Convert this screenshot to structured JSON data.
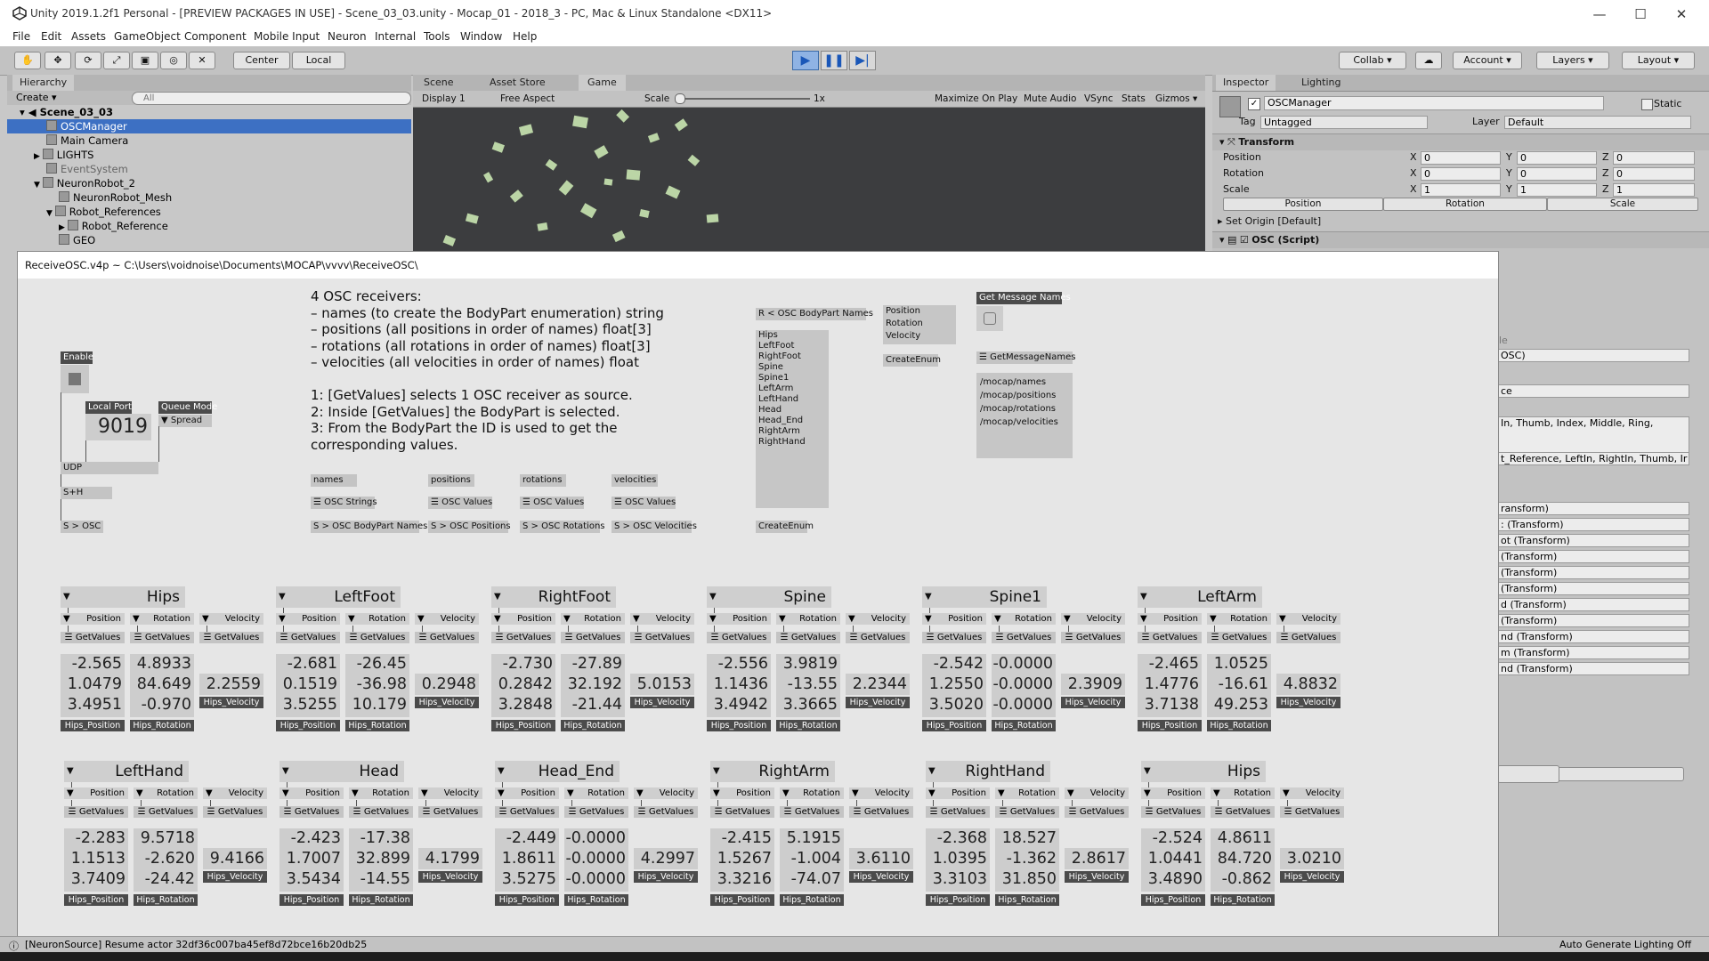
{
  "window": {
    "title": "Unity 2019.1.2f1 Personal - [PREVIEW PACKAGES IN USE] - Scene_03_03.unity - Mocap_01 - 2018_3 - PC, Mac & Linux Standalone <DX11>",
    "minimize": "—",
    "maximize": "☐",
    "close": "✕"
  },
  "menu": [
    "File",
    "Edit",
    "Assets",
    "GameObject",
    "Component",
    "Mobile Input",
    "Neuron",
    "Internal",
    "Tools",
    "Window",
    "Help"
  ],
  "toolbar": {
    "center": "Center",
    "local": "Local",
    "collab": "Collab ▾",
    "account": "Account ▾",
    "layers": "Layers ▾",
    "layout": "Layout ▾"
  },
  "hierarchy": {
    "tab": "Hierarchy",
    "create": "Create ▾",
    "search_placeholder": "All",
    "scene": "Scene_03_03",
    "items": [
      {
        "label": "OSCManager",
        "selected": true
      },
      {
        "label": "Main Camera"
      },
      {
        "label": "LIGHTS"
      },
      {
        "label": "EventSystem"
      },
      {
        "label": "NeuronRobot_2"
      },
      {
        "label": "NeuronRobot_Mesh"
      },
      {
        "label": "Robot_References"
      },
      {
        "label": "Robot_Reference"
      },
      {
        "label": "GEO"
      }
    ]
  },
  "game": {
    "tabs": [
      "Scene",
      "Asset Store",
      "Game"
    ],
    "display": "Display 1",
    "aspect": "Free Aspect",
    "scale_label": "Scale",
    "scale_value": "1x",
    "options": [
      "Maximize On Play",
      "Mute Audio",
      "VSync",
      "Stats",
      "Gizmos ▾"
    ]
  },
  "inspector": {
    "tabs": [
      "Inspector",
      "Lighting"
    ],
    "object_name": "OSCManager",
    "static_label": "Static",
    "tag_label": "Tag",
    "tag_value": "Untagged",
    "layer_label": "Layer",
    "layer_value": "Default",
    "transform_title": "Transform",
    "rows": [
      {
        "label": "Position",
        "x": "0",
        "y": "0",
        "z": "0"
      },
      {
        "label": "Rotation",
        "x": "0",
        "y": "0",
        "z": "0"
      },
      {
        "label": "Scale",
        "x": "1",
        "y": "1",
        "z": "1"
      }
    ],
    "buttons": [
      "Position",
      "Rotation",
      "Scale"
    ],
    "set_origin": "Set Origin [Default]",
    "script_title": "OSC (Script)",
    "partial_lines": [
      "le",
      "OSC)",
      "ce",
      "In, Thumb, Index, Middle, Ring,",
      "t_Reference, LeftIn, RightIn, Thumb, Ir",
      "ransform)",
      ": (Transform)",
      "ot (Transform)",
      "(Transform)",
      "(Transform)",
      "(Transform)",
      "d (Transform)",
      "(Transform)",
      "nd (Transform)",
      "m (Transform)",
      "nd (Transform)"
    ],
    "auto_generate": "Auto Generate Lighting Off"
  },
  "patch": {
    "title": "ReceiveOSC.v4p ~  C:\\Users\\voidnoise\\Documents\\MOCAP\\vvvv\\ReceiveOSC\\",
    "comment": "4 OSC receivers:\n– names (to create the BodyPart enumeration) string\n– positions (all positions in order of names) float[3]\n– rotations (all rotations in order of names) float[3]\n– velocities (all velocities in order of names) float\n\n1: [GetValues] selects 1 OSC receiver as source.\n2: Inside [GetValues] the BodyPart is selected.\n3: From the BodyPart the ID is used to get the\ncorresponding values.",
    "enable_label": "Enable",
    "local_port_label": "Local Port",
    "local_port": "9019",
    "queue_mode_label": "Queue Mode",
    "queue_mode": "Spread",
    "udp": "UDP",
    "sh": "S+H",
    "s_osc": "S > OSC",
    "receivers": [
      {
        "name": "names",
        "node": "OSC Strings",
        "send": "S > OSC BodyPart Names"
      },
      {
        "name": "positions",
        "node": "OSC Values",
        "send": "S > OSC Positions"
      },
      {
        "name": "rotations",
        "node": "OSC Values",
        "send": "S > OSC Rotations"
      },
      {
        "name": "velocities",
        "node": "OSC Values",
        "send": "S > OSC Velocities"
      }
    ],
    "bodypart_names_label": "R < OSC BodyPart Names",
    "bodypart_names": [
      "Hips",
      "LeftFoot",
      "RightFoot",
      "Spine",
      "Spine1",
      "LeftArm",
      "LeftHand",
      "Head",
      "Head_End",
      "RightArm",
      "RightHand"
    ],
    "create_enum_1": "CreateEnum",
    "enum_list": [
      "Position",
      "Rotation",
      "Velocity"
    ],
    "create_enum_2": "CreateEnum",
    "get_message_names": "Get Message Names",
    "get_message_names_node": "GetMessageNames",
    "message_names": [
      "/mocap/names",
      "/mocap/positions",
      "/mocap/rotations",
      "/mocap/velocities"
    ],
    "sub_labels": {
      "position": "Position",
      "rotation": "Rotation",
      "velocity": "Velocity",
      "getvalues": "GetValues",
      "pos_out": "Hips_Position",
      "rot_out": "Hips_Rotation",
      "vel_out": "Hips_Velocity"
    },
    "bodyparts": [
      {
        "name": "Hips",
        "pos": [
          "-2.565",
          "1.0479",
          "3.4951"
        ],
        "rot": [
          "4.8933",
          "84.649",
          "-0.970"
        ],
        "vel": "2.2559"
      },
      {
        "name": "LeftFoot",
        "pos": [
          "-2.681",
          "0.1519",
          "3.5255"
        ],
        "rot": [
          "-26.45",
          "-36.98",
          "10.179"
        ],
        "vel": "0.2948"
      },
      {
        "name": "RightFoot",
        "pos": [
          "-2.730",
          "0.2842",
          "3.2848"
        ],
        "rot": [
          "-27.89",
          "32.192",
          "-21.44"
        ],
        "vel": "5.0153"
      },
      {
        "name": "Spine",
        "pos": [
          "-2.556",
          "1.1436",
          "3.4942"
        ],
        "rot": [
          "3.9819",
          "-13.55",
          "3.3665"
        ],
        "vel": "2.2344"
      },
      {
        "name": "Spine1",
        "pos": [
          "-2.542",
          "1.2550",
          "3.5020"
        ],
        "rot": [
          "-0.0000",
          "-0.0000",
          "-0.0000"
        ],
        "vel": "2.3909"
      },
      {
        "name": "LeftArm",
        "pos": [
          "-2.465",
          "1.4776",
          "3.7138"
        ],
        "rot": [
          "1.0525",
          "-16.61",
          "49.253"
        ],
        "vel": "4.8832"
      },
      {
        "name": "LeftHand",
        "pos": [
          "-2.283",
          "1.1513",
          "3.7409"
        ],
        "rot": [
          "9.5718",
          "-2.620",
          "-24.42"
        ],
        "vel": "9.4166"
      },
      {
        "name": "Head",
        "pos": [
          "-2.423",
          "1.7007",
          "3.5434"
        ],
        "rot": [
          "-17.38",
          "32.899",
          "-14.55"
        ],
        "vel": "4.1799"
      },
      {
        "name": "Head_End",
        "pos": [
          "-2.449",
          "1.8611",
          "3.5275"
        ],
        "rot": [
          "-0.0000",
          "-0.0000",
          "-0.0000"
        ],
        "vel": "4.2997"
      },
      {
        "name": "RightArm",
        "pos": [
          "-2.415",
          "1.5267",
          "3.3216"
        ],
        "rot": [
          "5.1915",
          "-1.004",
          "-74.07"
        ],
        "vel": "3.6110"
      },
      {
        "name": "RightHand",
        "pos": [
          "-2.368",
          "1.0395",
          "3.3103"
        ],
        "rot": [
          "18.527",
          "-1.362",
          "31.850"
        ],
        "vel": "2.8617"
      },
      {
        "name": "Hips",
        "pos": [
          "-2.524",
          "1.0441",
          "3.4890"
        ],
        "rot": [
          "4.8611",
          "84.720",
          "-0.862"
        ],
        "vel": "3.0210"
      }
    ]
  },
  "status": "[NeuronSource] Resume actor 32df36c007ba45ef8d72bce16b20db25"
}
